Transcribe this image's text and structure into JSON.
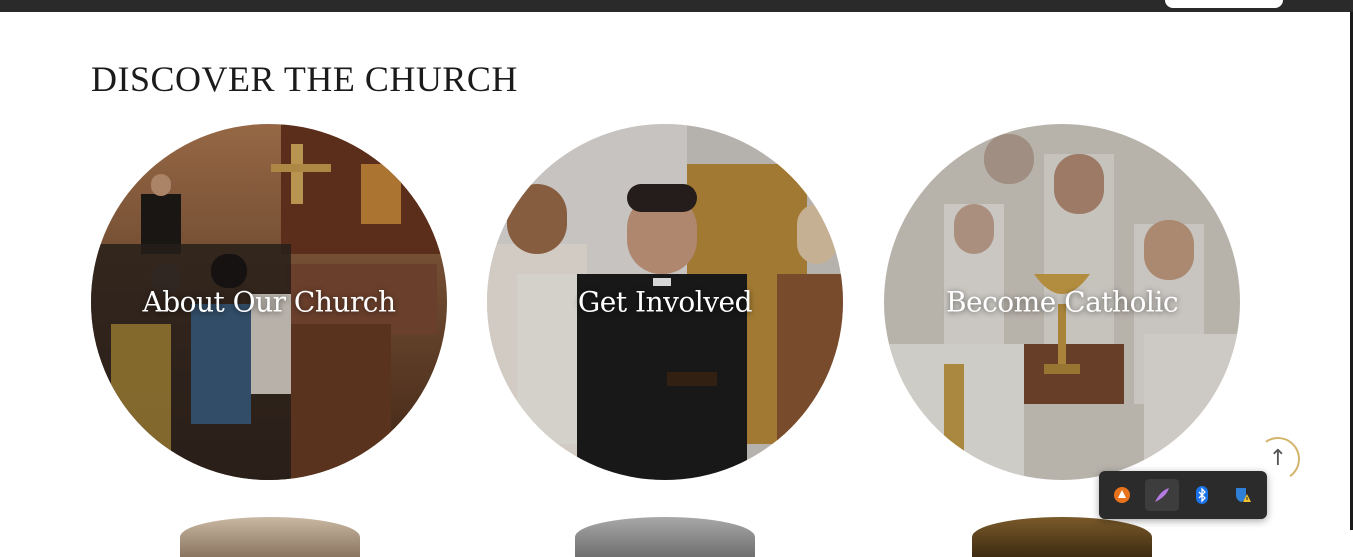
{
  "section": {
    "title": "DISCOVER THE CHURCH"
  },
  "cards": [
    {
      "label": "About Our Church"
    },
    {
      "label": "Get Involved"
    },
    {
      "label": "Become Catholic"
    }
  ],
  "scroll_top": {
    "icon": "↑"
  },
  "tray_icons": [
    "vlc-icon",
    "feather-pen-icon",
    "bluetooth-icon",
    "windows-security-warning-icon"
  ],
  "colors": {
    "topbar": "#2a2a2a",
    "accent_gold": "#d3b46a",
    "title": "#1b1b1b"
  }
}
